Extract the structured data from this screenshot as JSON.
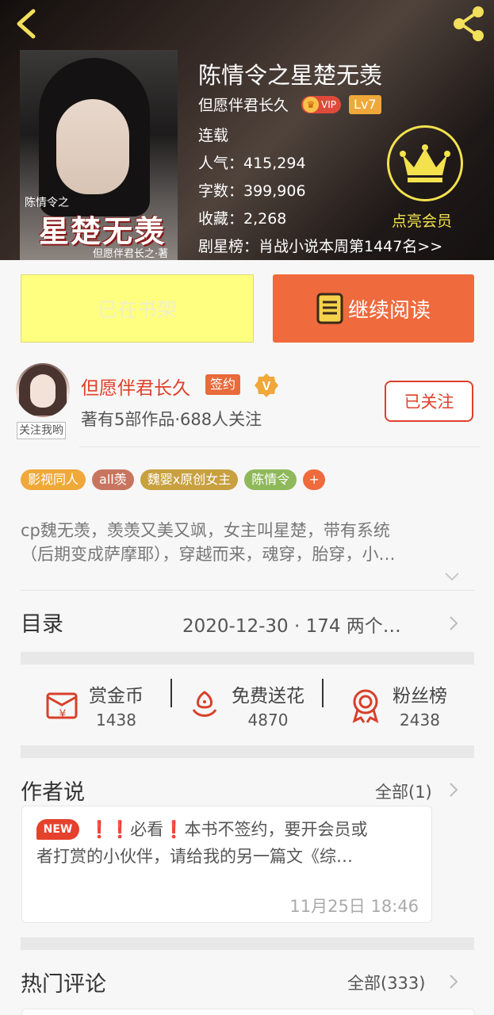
{
  "header": {
    "back_icon": "chevron-left-icon",
    "share_icon": "share-icon",
    "cover": {
      "small_text": "陈情令之",
      "big_title": "星楚无羡",
      "author_text": "但愿伴君长之·著"
    },
    "book_title": "陈情令之星楚无羡",
    "author": "但愿伴君长久",
    "vip_label": "VIP",
    "level": "Lv7",
    "status": "连载",
    "popularity": "人气：415,294",
    "word_count": "字数：399,906",
    "favorites": "收藏：2,268",
    "ranking": "剧星榜：肖战小说本周第1447名>>",
    "member_label": "点亮会员",
    "member_color": "#f3e24e"
  },
  "actions": {
    "shelf_label": "已在书架",
    "read_label": "继续阅读",
    "read_color": "#ef6a3c"
  },
  "author_block": {
    "name": "但愿伴君长久",
    "sign_badge": "签约",
    "stats": "著有5部作品·688人关注",
    "follow_me": "关注我哟",
    "followed_label": "已关注",
    "accent": "#e0402a"
  },
  "tags": [
    {
      "label": "影视同人",
      "color": "#f0a83a"
    },
    {
      "label": "all羡",
      "color": "#c87560"
    },
    {
      "label": "魏婴x原创女主",
      "color": "#c8a040"
    },
    {
      "label": "陈情令",
      "color": "#8fb85a"
    }
  ],
  "tag_add": "+",
  "summary": {
    "line1": "cp魏无羡，羡羡又美又飒，女主叫星楚，带有系统",
    "line2": "（后期变成萨摩耶），穿越而来，魂穿，胎穿，小…"
  },
  "catalog": {
    "title": "目录",
    "info": "2020-12-30 · 174 两个…"
  },
  "rewards": [
    {
      "label": "赏金币",
      "value": "1438",
      "icon": "red-envelope-icon"
    },
    {
      "label": "免费送花",
      "value": "4870",
      "icon": "flower-icon"
    },
    {
      "label": "粉丝榜",
      "value": "2438",
      "icon": "medal-icon"
    }
  ],
  "author_says": {
    "title": "作者说",
    "more": "全部(1)",
    "new_badge": "NEW",
    "line1": "❗❗必看❗本书不签约，要开会员或",
    "line2": "者打赏的小伙伴，请给我的另一篇文《综…",
    "time": "11月25日  18:46"
  },
  "hot_comments": {
    "title": "热门评论",
    "more": "全部(333)"
  }
}
